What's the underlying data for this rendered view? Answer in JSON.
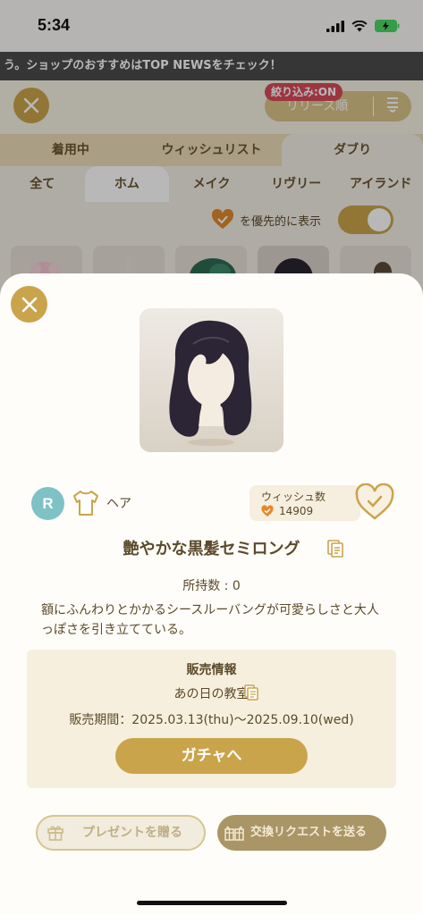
{
  "status_bar": {
    "time": "5:34"
  },
  "ticker": {
    "text": "う。ショップのおすすめはTOP NEWSをチェック！"
  },
  "header": {
    "filter_badge": "絞り込み:ON",
    "sort_label": "リリース順"
  },
  "tabs": [
    {
      "label": "着用中",
      "active": false
    },
    {
      "label": "ウィッシュリスト",
      "active": false
    },
    {
      "label": "ダブり",
      "active": true
    }
  ],
  "subtabs": [
    {
      "label": "全て",
      "active": false
    },
    {
      "label": "ホム",
      "active": true
    },
    {
      "label": "メイク",
      "active": false
    },
    {
      "label": "リヴリー",
      "active": false
    },
    {
      "label": "アイランド",
      "active": false
    }
  ],
  "priority": {
    "label": "を優先的に表示",
    "toggle_on": true
  },
  "item": {
    "rank": "R",
    "category": "ヘア",
    "wish_title": "ウィッシュ数",
    "wish_count": "14909",
    "name": "艶やかな黒髪セミロング",
    "owned": "所持数 : 0",
    "description": "額にふんわりとかかるシースルーバングが可愛らしさと大人っぽさを引き立てている。"
  },
  "sale": {
    "title": "販売情報",
    "source": "あの日の教室",
    "period": "販売期間：2025.03.13(thu)〜2025.09.10(wed)",
    "button": "ガチャへ"
  },
  "actions": {
    "present": "プレゼントを贈る",
    "trade": "交換リクエストを送る"
  },
  "colors": {
    "accent_gold": "#c9a44a",
    "rank_teal": "#7fc2c5",
    "badge_red": "#d94a5a"
  }
}
